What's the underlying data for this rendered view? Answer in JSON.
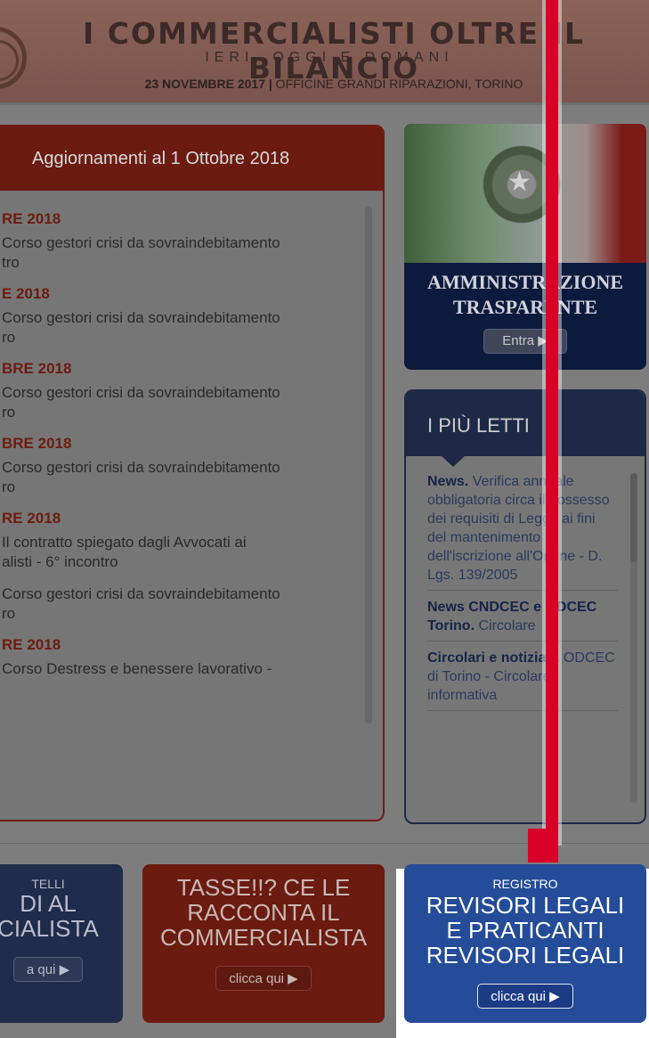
{
  "banner": {
    "title": "I COMMERCIALISTI OLTRE IL BILANCIO",
    "subtitle": "IERI, OGGI E DOMANI",
    "date": "23 NOVEMBRE 2017 |",
    "location": " OFFICINE GRANDI RIPARAZIONI, TORINO"
  },
  "news_panel": {
    "header": "Aggiornamenti al 1 Ottobre 2018",
    "entries": [
      {
        "date": "RE 2018",
        "items": [
          "Corso gestori crisi da sovraindebitamento\ntro"
        ]
      },
      {
        "date": "E 2018",
        "items": [
          "Corso gestori crisi da sovraindebitamento\nro"
        ]
      },
      {
        "date": "BRE 2018",
        "items": [
          "Corso gestori crisi da sovraindebitamento\nro"
        ]
      },
      {
        "date": "BRE 2018",
        "items": [
          "Corso gestori crisi da sovraindebitamento\nro"
        ]
      },
      {
        "date": "RE 2018",
        "items": [
          "Il contratto spiegato dagli Avvocati ai\nalisti - 6° incontro",
          "Corso gestori crisi da sovraindebitamento\nro"
        ]
      },
      {
        "date": "RE 2018",
        "items": [
          "Corso Destress e benessere lavorativo -"
        ]
      }
    ]
  },
  "amministrazione": {
    "title_line1": "AMMINISTRAZIONE",
    "title_line2": "TRASPARENTE",
    "button": "Entra",
    "button_icon": "play-icon"
  },
  "piu_letti": {
    "header": "I PIÙ LETTI",
    "items": [
      {
        "bold": "News.",
        "text": " Verifica annuale obbligatoria circa il possesso dei requisiti di Legge ai fini del mantenimento dell'iscrizione all'Ordine - D. Lgs. 139/2005"
      },
      {
        "bold": "News CNDCEC e ODCEC Torino.",
        "text": " Circolare"
      },
      {
        "bold": "Circolari e notiziari.",
        "text": " ODCEC di Torino - Circolare informativa"
      }
    ]
  },
  "tiles": {
    "tile1": {
      "small": "TELLI",
      "big": "DI AL\nCIALISTA",
      "button": "a qui ▶"
    },
    "tile2": {
      "small": "",
      "big": "TASSE!!? CE LE\nRACCONTA IL\nCOMMERCIALISTA",
      "button": "clicca qui ▶"
    },
    "tile3": {
      "small": "REGISTRO",
      "big": "REVISORI LEGALI\nE PRATICANTI\nREVISORI LEGALI",
      "button": "clicca qui ▶"
    }
  },
  "colors": {
    "marker": "#d80027",
    "tile3_bg": "#244c98",
    "news_header_bg": "#6b1b12"
  }
}
